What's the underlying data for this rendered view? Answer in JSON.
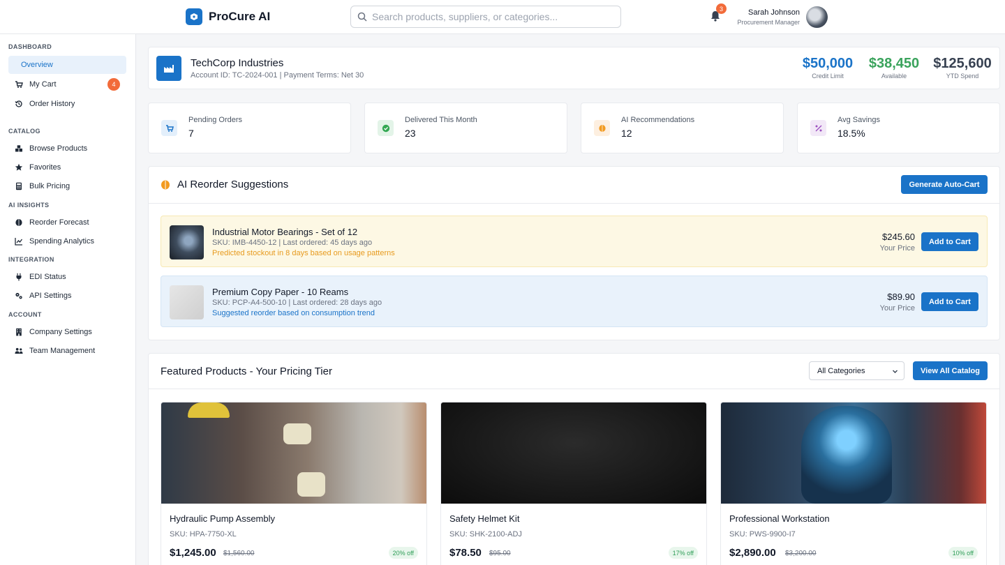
{
  "app": {
    "name": "ProCure AI"
  },
  "search": {
    "placeholder": "Search products, suppliers, or categories..."
  },
  "notifications": {
    "count": "3"
  },
  "user": {
    "name": "Sarah Johnson",
    "role": "Procurement Manager"
  },
  "sidebar": {
    "sections": [
      {
        "title": "DASHBOARD",
        "items": [
          {
            "label": "Overview",
            "icon": "home-icon",
            "active": true
          },
          {
            "label": "My Cart",
            "icon": "cart-icon",
            "badge": "4"
          },
          {
            "label": "Order History",
            "icon": "history-icon"
          }
        ]
      },
      {
        "title": "CATALOG",
        "items": [
          {
            "label": "Browse Products",
            "icon": "boxes-icon"
          },
          {
            "label": "Favorites",
            "icon": "star-icon"
          },
          {
            "label": "Bulk Pricing",
            "icon": "calculator-icon"
          }
        ]
      },
      {
        "title": "AI INSIGHTS",
        "items": [
          {
            "label": "Reorder Forecast",
            "icon": "brain-icon"
          },
          {
            "label": "Spending Analytics",
            "icon": "chart-line-icon"
          }
        ]
      },
      {
        "title": "INTEGRATION",
        "items": [
          {
            "label": "EDI Status",
            "icon": "plug-icon"
          },
          {
            "label": "API Settings",
            "icon": "cogs-icon"
          }
        ]
      },
      {
        "title": "ACCOUNT",
        "items": [
          {
            "label": "Company Settings",
            "icon": "building-icon"
          },
          {
            "label": "Team Management",
            "icon": "users-icon"
          }
        ]
      }
    ]
  },
  "account": {
    "company": "TechCorp Industries",
    "details": "Account ID: TC-2024-001 | Payment Terms: Net 30",
    "metrics": [
      {
        "value": "$50,000",
        "label": "Credit Limit",
        "color": "#1a73c8"
      },
      {
        "value": "$38,450",
        "label": "Available",
        "color": "#3aa35c"
      },
      {
        "value": "$125,600",
        "label": "YTD Spend",
        "color": "#374151"
      }
    ]
  },
  "stats": [
    {
      "label": "Pending Orders",
      "value": "7",
      "icon": "cart-icon",
      "bg": "#e3effb",
      "fg": "#1a73c8"
    },
    {
      "label": "Delivered This Month",
      "value": "23",
      "icon": "check-circle-icon",
      "bg": "#e3f4e8",
      "fg": "#34a853"
    },
    {
      "label": "AI Recommendations",
      "value": "12",
      "icon": "brain-icon",
      "bg": "#fdefe0",
      "fg": "#f29a1f"
    },
    {
      "label": "Avg Savings",
      "value": "18.5%",
      "icon": "percent-icon",
      "bg": "#f2e8f7",
      "fg": "#9c4fc0"
    }
  ],
  "suggestions": {
    "title": "AI Reorder Suggestions",
    "generate_label": "Generate Auto-Cart",
    "items": [
      {
        "name": "Industrial Motor Bearings - Set of 12",
        "sku": "SKU: IMB-4450-12 | Last ordered: 45 days ago",
        "note": "Predicted stockout in 8 days based on usage patterns",
        "price": "$245.60",
        "price_label": "Your Price",
        "button": "Add to Cart"
      },
      {
        "name": "Premium Copy Paper - 10 Reams",
        "sku": "SKU: PCP-A4-500-10 | Last ordered: 28 days ago",
        "note": "Suggested reorder based on consumption trend",
        "price": "$89.90",
        "price_label": "Your Price",
        "button": "Add to Cart"
      }
    ]
  },
  "featured": {
    "title": "Featured Products - Your Pricing Tier",
    "category_select": "All Categories",
    "view_all_label": "View All Catalog",
    "products": [
      {
        "name": "Hydraulic Pump Assembly",
        "sku": "SKU: HPA-7750-XL",
        "price": "$1,245.00",
        "old_price": "$1,560.00",
        "discount": "20% off"
      },
      {
        "name": "Safety Helmet Kit",
        "sku": "SKU: SHK-2100-ADJ",
        "price": "$78.50",
        "old_price": "$95.00",
        "discount": "17% off"
      },
      {
        "name": "Professional Workstation",
        "sku": "SKU: PWS-9900-I7",
        "price": "$2,890.00",
        "old_price": "$3,200.00",
        "discount": "10% off"
      }
    ]
  }
}
